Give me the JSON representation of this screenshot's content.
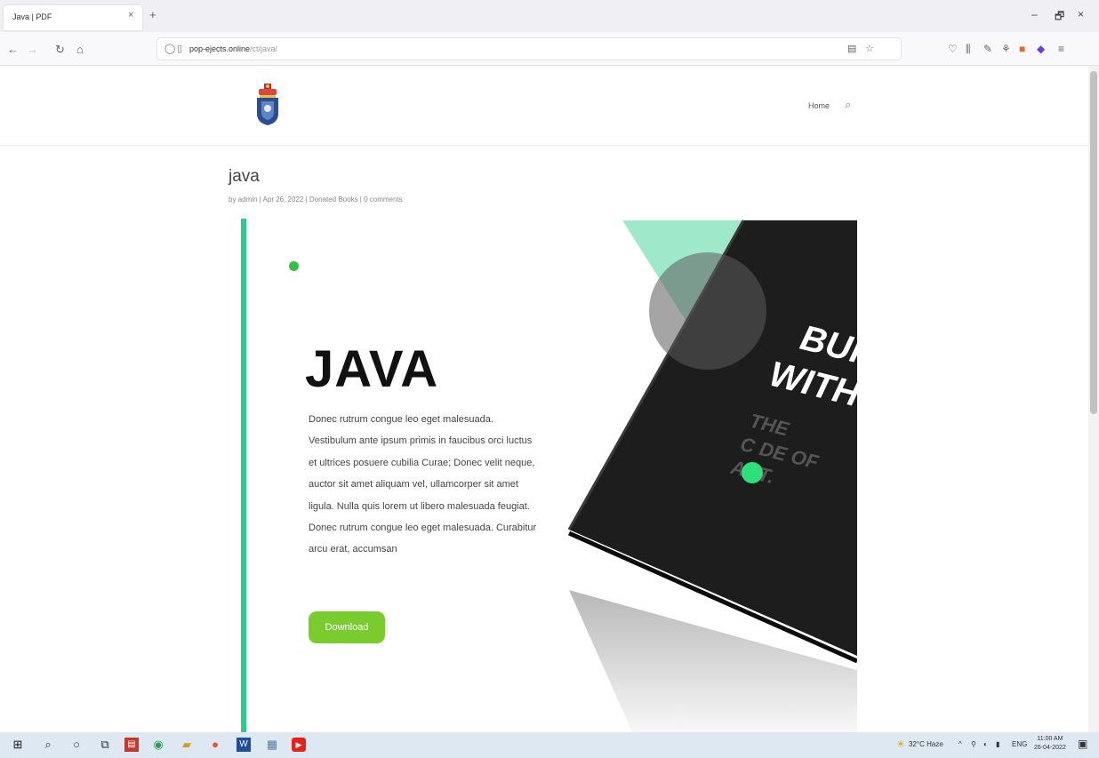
{
  "browser": {
    "tab_title": "Java | PDF",
    "tab_close": "×",
    "new_tab": "+",
    "window_controls": {
      "minimize": "–",
      "maximize": "🗗",
      "close": "×"
    },
    "nav": {
      "back": "←",
      "forward": "→",
      "reload": "↻",
      "home": "⌂"
    },
    "url_domain": "pop-ejects.online",
    "url_path": "/ct/java/",
    "icons": [
      "shield-icon",
      "lock-icon",
      "reader-icon",
      "bookmark-star-icon",
      "pocket-icon",
      "library-icon",
      "pen-icon",
      "puzzle-icon",
      "extension-icon",
      "purple-extension-icon",
      "menu-icon"
    ]
  },
  "site": {
    "nav_home": "Home",
    "search_icon": "⌕"
  },
  "post": {
    "title": "java",
    "meta": "by admin | Apr 26, 2022 | Donated Books | 0 comments",
    "hero_title": "JAVA",
    "hero_body": "Donec rutrum congue leo eget malesuada. Vestibulum ante ipsum primis in faucibus orci luctus et ultrices posuere cubilia Curae; Donec velit neque, auctor sit amet aliquam vel, ullamcorper sit amet ligula. Nulla quis lorem ut libero malesuada feugiat. Donec rutrum congue leo eget malesuada. Curabitur arcu erat, accumsan",
    "download_label": "Download",
    "book_line1": "BUIL",
    "book_line2": "WITH",
    "book_sub1": "THE",
    "book_sub2": "C  DE OF",
    "book_sub3": "ART."
  },
  "colors": {
    "accent_green": "#2ecc8a",
    "button_green": "#7acb2e",
    "dot_green": "#34c040",
    "book_dark": "#1d1d1d",
    "mint": "#9fe8c9"
  },
  "taskbar": {
    "icons": [
      "windows-start-icon",
      "search-icon",
      "cortana-icon",
      "task-view-icon",
      "pdf-app-icon",
      "chrome-icon",
      "files-icon",
      "firefox-icon",
      "word-icon",
      "calculator-icon",
      "youtube-icon"
    ],
    "weather": "32°C Haze",
    "tray_arrow": "^",
    "language": "ENG",
    "time": "11:00 AM",
    "date": "26-04-2022"
  }
}
